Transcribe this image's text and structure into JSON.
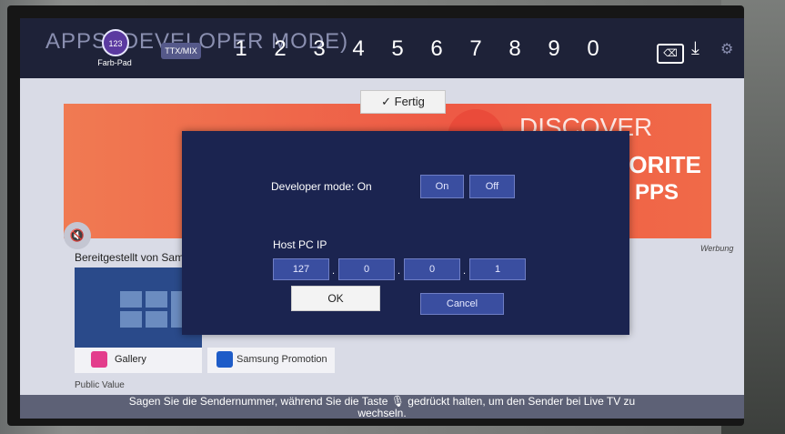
{
  "top_bar": {
    "background_title": "APPS (DEVELOPER MODE)",
    "farb_pad": {
      "badge": "123",
      "label": "Farb-Pad"
    },
    "ttx_label": "TTX/MIX",
    "digits": [
      "1",
      "2",
      "3",
      "4",
      "5",
      "6",
      "7",
      "8",
      "9",
      "0"
    ]
  },
  "fertig_label": "✓ Fertig",
  "banner": {
    "line1": "DISCOVER",
    "line2": "VORITE",
    "line3": "PPS"
  },
  "werbung": "Werbung",
  "section_title": "Bereitgestellt von Sams",
  "cards": {
    "gallery": "Gallery",
    "promotion": "Samsung Promotion"
  },
  "public_value": "Public Value",
  "dialog": {
    "developer_mode_label": "Developer mode: On",
    "on_label": "On",
    "off_label": "Off",
    "host_label": "Host PC IP",
    "ip": [
      "127",
      "0",
      "0",
      "1"
    ],
    "ok_label": "OK",
    "cancel_label": "Cancel"
  },
  "subtitle": {
    "line1": "Sagen Sie die Sendernummer, während Sie die Taste 🎙 gedrückt halten, um den Sender bei Live TV zu",
    "line2": "wechseln."
  }
}
